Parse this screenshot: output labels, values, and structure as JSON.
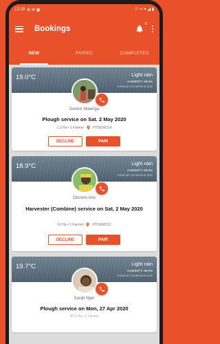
{
  "status_bar": {
    "time": "12:19",
    "right_icons": "⚐ ⏦ ▾ ◢ ▮"
  },
  "header": {
    "title": "Bookings",
    "notification_count": "6"
  },
  "tabs": [
    {
      "label": "NEW"
    },
    {
      "label": "PAIRED"
    },
    {
      "label": "COMPLETED"
    }
  ],
  "bookings": [
    {
      "temperature": "19.0°C",
      "condition": "Light rain",
      "humidity": "HUMIDITY: 69.0%",
      "forecast_note": "FORECAST ON SERVICE DATE",
      "farmer": "Dennis Mwenga",
      "service": "Plough service on Sat. 2 May 2020",
      "size": "1.3 Ha • 1 Farmer",
      "location": "HTDEMO14",
      "decline_label": "DECLINE",
      "pair_label": "PAIR"
    },
    {
      "temperature": "18.9°C",
      "condition": "Light rain",
      "humidity": "HUMIDITY: 69.0%",
      "forecast_note": "FORECAST ON SERVICE DATE",
      "farmer": "Oluremi Ann",
      "service": "Harvester (Combine) service on Sat, 2 May 2020",
      "size": "10 Ha • 1 Farmer",
      "location": "HTDEMO12",
      "decline_label": "DECLINE",
      "pair_label": "PAIR"
    },
    {
      "temperature": "19.7°C",
      "condition": "Light rain",
      "humidity": "HUMIDITY: 69.0%",
      "forecast_note": "FORECAST ON SERVICE DATE",
      "farmer": "Sarah Njeri",
      "service": "Plough service on Mon, 27 Apr 2020",
      "size": "20.3 Ha • 1 Farmer"
    }
  ],
  "colors": {
    "accent": "#e8512a",
    "weather_bg": "#5c6e7b"
  }
}
